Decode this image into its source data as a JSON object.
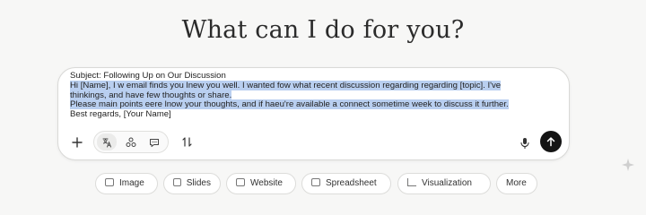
{
  "headline": "What can I do for you?",
  "composer": {
    "lines": [
      "Subject: Following Up on Our Discussion",
      "Hi [Name], I w email finds you lnew you well. I wanted fow what recent discussion regarding regarding [topic]. I've",
      "thinkings, and have few thoughts or share.",
      "Please main points eere lnow your thoughts, and if haeu're available a connect sometime week to discuss it further.",
      "Best regards, [Your Name]"
    ],
    "selected_line_indexes": [
      1,
      2,
      3
    ],
    "selection_color": "#b9cff0"
  },
  "toolbar": {
    "add": {
      "icon": "plus-icon"
    },
    "tools": [
      {
        "icon": "sparkle-translate-icon",
        "active": true
      },
      {
        "icon": "connector-icon",
        "active": false
      },
      {
        "icon": "chat-bubble-icon",
        "active": false
      }
    ],
    "swap": {
      "icon": "swap-arrows-icon"
    },
    "mic": {
      "icon": "microphone-icon"
    },
    "send": {
      "icon": "send-arrow-icon",
      "color": "#141414"
    }
  },
  "quick_actions": [
    {
      "label": "Image",
      "icon": "image-icon"
    },
    {
      "label": "Slides",
      "icon": "slides-icon"
    },
    {
      "label": "Website",
      "icon": "website-icon"
    },
    {
      "label": "Spreadsheet",
      "icon": "spreadsheet-icon"
    },
    {
      "label": "Visualization",
      "icon": "chart-icon"
    },
    {
      "label": "More",
      "icon": ""
    }
  ]
}
